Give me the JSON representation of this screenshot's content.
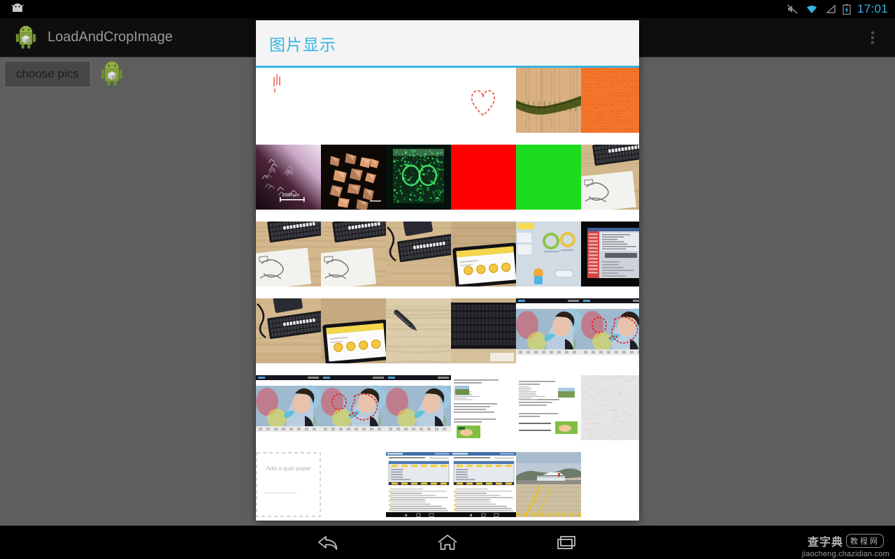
{
  "status_bar": {
    "time": "17:01",
    "icons": [
      "mute-icon",
      "wifi-icon",
      "signal-icon",
      "battery-charging-icon"
    ],
    "accent_color": "#33b5e5"
  },
  "action_bar": {
    "app_icon": "android-robot-icon",
    "title": "LoadAndCropImage",
    "overflow_icon": "overflow-menu-icon",
    "background_color": "#0e0e0e",
    "title_color": "#9a9a9a"
  },
  "app_content": {
    "choose_button_label": "choose pics",
    "preview_icon": "android-robot-icon",
    "background_color": "#5e5e5e"
  },
  "dialog": {
    "title": "图片显示",
    "title_color": "#33b5e5",
    "accent_line_color": "#33b5e5",
    "header_background": "#f4f4f4",
    "body_background": "#ffffff",
    "grid": {
      "columns": 6,
      "cell_size": 93,
      "rows": [
        [
          {
            "name": "sketch-red-marks",
            "type": "sketch-white",
            "bg": "#ffffff",
            "accent": "#e8443a"
          },
          {
            "name": "blank-white",
            "type": "blank",
            "bg": "#ffffff"
          },
          {
            "name": "blank-white-2",
            "type": "blank",
            "bg": "#ffffff"
          },
          {
            "name": "sketch-red-heart",
            "type": "heart-white",
            "bg": "#ffffff",
            "accent": "#e8443a"
          },
          {
            "name": "wood-bamboo-texture",
            "type": "wood",
            "bg": "#d8ae7e"
          },
          {
            "name": "orange-brick-texture",
            "type": "brick",
            "bg": "#f2762a"
          }
        ],
        [
          {
            "name": "microscopy-purple-crystal",
            "type": "micro-purple",
            "bg": "#2a1420"
          },
          {
            "name": "microscopy-orange-crystals",
            "type": "micro-orange",
            "bg": "#100a06"
          },
          {
            "name": "microscopy-green-cells",
            "type": "micro-green",
            "bg": "#061206"
          },
          {
            "name": "solid-red",
            "type": "solid",
            "bg": "#fe0000"
          },
          {
            "name": "solid-green",
            "type": "solid",
            "bg": "#1ddc1d"
          },
          {
            "name": "desk-keyboard-notebook",
            "type": "desk-a",
            "bg": "#cdb68e"
          }
        ],
        [
          {
            "name": "desk-keyboard-notes-1",
            "type": "desk-a",
            "bg": "#cdb68e"
          },
          {
            "name": "desk-keyboard-notes-2",
            "type": "desk-b",
            "bg": "#c9b089"
          },
          {
            "name": "desk-keyboard-cable",
            "type": "desk-c",
            "bg": "#b9a588"
          },
          {
            "name": "tablet-on-desk",
            "type": "tablet",
            "bg": "#b8a184"
          },
          {
            "name": "tablet-screen-ui",
            "type": "screen-ui",
            "bg": "#cfd6dd"
          },
          {
            "name": "laptop-dark-screenshot",
            "type": "dark-screen",
            "bg": "#0b0b0b"
          }
        ],
        [
          {
            "name": "desk-keyboard-wide",
            "type": "desk-c",
            "bg": "#bfac8c"
          },
          {
            "name": "desk-tablet-notebook",
            "type": "tablet",
            "bg": "#c2a87f"
          },
          {
            "name": "pen-on-desk",
            "type": "pen",
            "bg": "#d8c9a9"
          },
          {
            "name": "black-keyboard-closeup",
            "type": "keyboard",
            "bg": "#1d1d21"
          },
          {
            "name": "photo-editor-girl-1",
            "type": "editor",
            "bg": "#b8c9d8"
          },
          {
            "name": "photo-editor-girl-2",
            "type": "editor-marked",
            "bg": "#b8c9d8"
          }
        ],
        [
          {
            "name": "photo-editor-girl-3",
            "type": "editor",
            "bg": "#b8c9d8"
          },
          {
            "name": "photo-editor-girl-4",
            "type": "editor-marked",
            "bg": "#b8c9d8"
          },
          {
            "name": "photo-editor-girl-5",
            "type": "editor",
            "bg": "#b8c9d8"
          },
          {
            "name": "document-page-1",
            "type": "doc",
            "bg": "#ffffff"
          },
          {
            "name": "document-page-2",
            "type": "doc2",
            "bg": "#ffffff"
          },
          {
            "name": "gray-paper-texture",
            "type": "gray-texture",
            "bg": "#d9d9d9"
          }
        ],
        [
          {
            "name": "add-quiz-paper-placeholder",
            "type": "placeholder",
            "bg": "#ffffff",
            "label": "Add a quiz paper"
          },
          {
            "name": "blank-white-3",
            "type": "blank",
            "bg": "#ffffff"
          },
          {
            "name": "screenshot-spreadsheet-1",
            "type": "screenshot",
            "bg": "#ffffff"
          },
          {
            "name": "screenshot-spreadsheet-2",
            "type": "screenshot",
            "bg": "#ffffff"
          },
          {
            "name": "airport-runway-photo",
            "type": "airport",
            "bg": "#b9a98e"
          },
          {
            "name": "blank-white-4",
            "type": "blank",
            "bg": "#ffffff"
          }
        ]
      ]
    }
  },
  "nav_bar": {
    "buttons": [
      {
        "name": "back-button",
        "icon": "back-arrow-icon"
      },
      {
        "name": "home-button",
        "icon": "home-icon"
      },
      {
        "name": "recents-button",
        "icon": "recents-icon"
      }
    ]
  },
  "watermark": {
    "brand": "查字典",
    "tag": "教程网",
    "url": "jiaocheng.chazidian.com"
  }
}
